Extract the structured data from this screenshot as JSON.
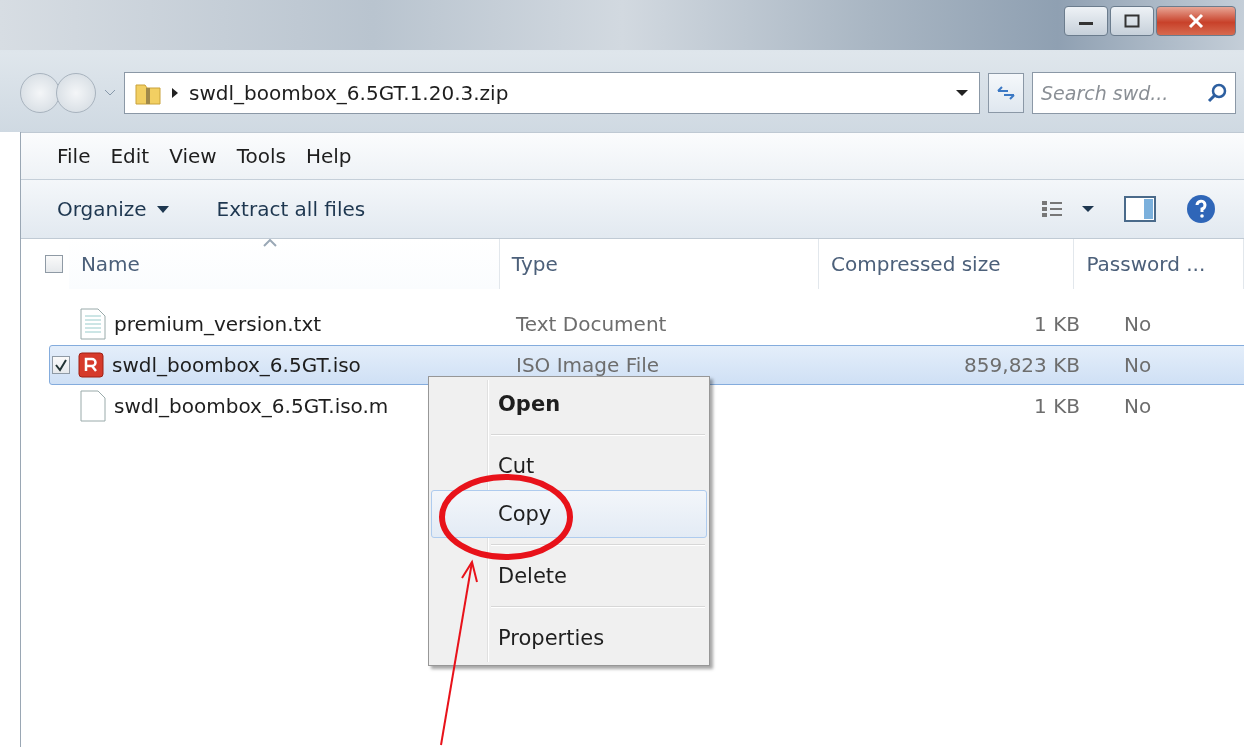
{
  "address_bar": {
    "path": "swdl_boombox_6.5GT.1.20.3.zip"
  },
  "search": {
    "placeholder": "Search swd..."
  },
  "menu_bar": [
    "File",
    "Edit",
    "View",
    "Tools",
    "Help"
  ],
  "toolbar": [
    {
      "label": "Organize",
      "dropdown": true
    },
    {
      "label": "Extract all files",
      "dropdown": false
    }
  ],
  "table": {
    "select_all": {
      "checked": false
    },
    "columns": [
      {
        "label": "Name",
        "sorted": true
      },
      {
        "label": "Type",
        "sorted": false
      },
      {
        "label": "Compressed size",
        "sorted": false
      },
      {
        "label": "Password ...",
        "sorted": false
      }
    ],
    "rows": [
      {
        "kind": "text",
        "name": "premium_version.txt",
        "type": "Text Document",
        "size": "1 KB",
        "password": "No",
        "selected": false
      },
      {
        "kind": "iso",
        "name": "swdl_boombox_6.5GT.iso",
        "type": "ISO Image File",
        "size": "859,823 KB",
        "password": "No",
        "selected": true
      },
      {
        "kind": "file",
        "name": "swdl_boombox_6.5GT.iso.m",
        "size": "1 KB",
        "password": "No",
        "selected": false
      }
    ]
  },
  "context_menu": {
    "groups": [
      [
        {
          "label": "Open",
          "default": true,
          "selected": false
        }
      ],
      [
        {
          "label": "Cut",
          "default": false,
          "selected": false
        },
        {
          "label": "Copy",
          "default": false,
          "selected": true
        }
      ],
      [
        {
          "label": "Delete",
          "default": false,
          "selected": false
        }
      ],
      [
        {
          "label": "Properties",
          "default": false,
          "selected": false
        }
      ]
    ]
  }
}
